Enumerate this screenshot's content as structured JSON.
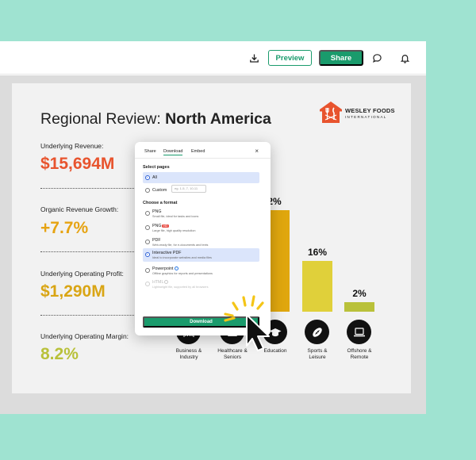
{
  "toolbar": {
    "preview_label": "Preview",
    "share_label": "Share"
  },
  "slide": {
    "title_prefix": "Regional Review: ",
    "title_region": "North America",
    "logo": {
      "name": "WESLEY FOODS",
      "sub": "INTERNATIONAL",
      "color": "#e8542e"
    },
    "metrics": [
      {
        "label": "Underlying Revenue:",
        "value": "$15,694M",
        "color": "#e8542e"
      },
      {
        "label": "Organic Revenue Growth:",
        "value": "+7.7%",
        "color": "#e6a312"
      },
      {
        "label": "Underlying Operating Profit:",
        "value": "$1,290M",
        "color": "#d9a514"
      },
      {
        "label": "Underlying Operating Margin:",
        "value": "8.2%",
        "color": "#b9c13a"
      }
    ]
  },
  "chart_data": {
    "type": "bar",
    "categories": [
      "Business & Industry",
      "Healthcare & Seniors",
      "Education",
      "Sports & Leisure",
      "Offshore & Remote"
    ],
    "values": [
      null,
      null,
      32,
      16,
      2
    ],
    "value_labels": [
      "",
      "",
      "2%",
      "16%",
      "2%"
    ],
    "colors": [
      "#e8542e",
      "#e6a312",
      "#e0a70e",
      "#e0d03a",
      "#b9c13a"
    ]
  },
  "sectors": [
    {
      "label_line1": "Business &",
      "label_line2": "Industry",
      "icon": "building-icon"
    },
    {
      "label_line1": "Healthcare &",
      "label_line2": "Seniors",
      "icon": "first-aid-icon"
    },
    {
      "label_line1": "Education",
      "label_line2": "",
      "icon": "graduation-cap-icon"
    },
    {
      "label_line1": "Sports &",
      "label_line2": "Leisure",
      "icon": "football-icon"
    },
    {
      "label_line1": "Offshore &",
      "label_line2": "Remote",
      "icon": "laptop-icon"
    }
  ],
  "dialog": {
    "tabs": [
      "Share",
      "Download",
      "Embed"
    ],
    "active_tab": "Download",
    "close_glyph": "×",
    "select_pages_label": "Select pages",
    "page_options": [
      {
        "label": "All",
        "selected": true
      },
      {
        "label": "Custom",
        "selected": false
      }
    ],
    "custom_placeholder": "eg. 1-5, 7, 10-11",
    "format_label": "Choose a format",
    "formats": [
      {
        "name": "PNG",
        "desc": "Small file, ideal for tasks and icons",
        "badge": "",
        "info": false,
        "selected": false,
        "disabled": false
      },
      {
        "name": "PNG",
        "desc": "Large file, high quality resolution",
        "badge": "HD",
        "info": false,
        "selected": false,
        "disabled": false
      },
      {
        "name": "PDF",
        "desc": "Web-ready file, for e-documents and texts",
        "badge": "",
        "info": false,
        "selected": false,
        "disabled": false
      },
      {
        "name": "Interactive PDF",
        "desc": "Ideal to incorporate websites and media files",
        "badge": "",
        "info": false,
        "selected": true,
        "disabled": false
      },
      {
        "name": "Powerpoint",
        "desc": "Offline graphics for reports and presentations",
        "badge": "",
        "info": true,
        "selected": false,
        "disabled": false
      },
      {
        "name": "HTML",
        "desc": "Lightweight file, supported by all browsers",
        "badge": "",
        "info": true,
        "selected": false,
        "disabled": true
      }
    ],
    "download_label": "Download"
  }
}
